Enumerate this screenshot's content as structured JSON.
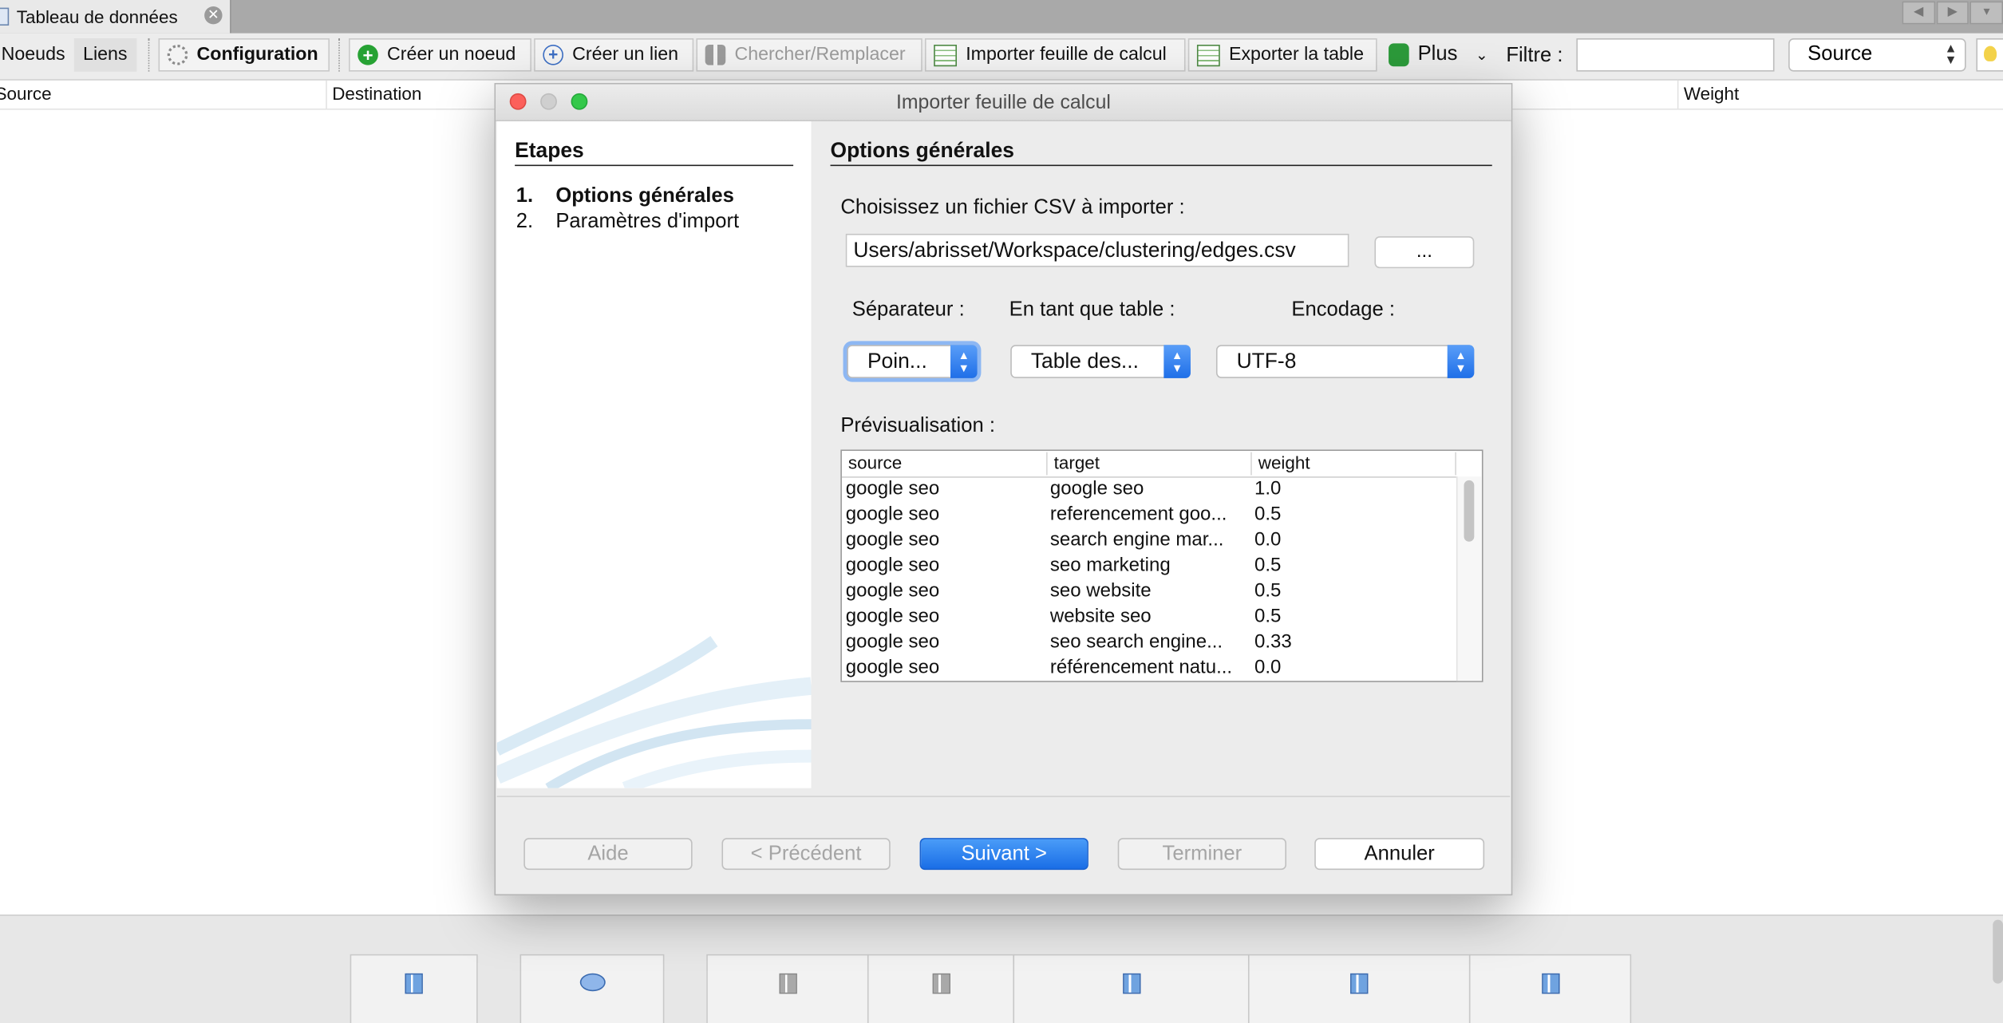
{
  "tab": {
    "title": "Tableau de données"
  },
  "toolbar": {
    "nodes": "Noeuds",
    "edges": "Liens",
    "config": "Configuration",
    "create_node": "Créer un noeud",
    "create_edge": "Créer un lien",
    "search_replace": "Chercher/Remplacer",
    "import_sheet": "Importer feuille de calcul",
    "export_table": "Exporter la table",
    "more": "Plus",
    "filter_label": "Filtre :",
    "filter_value": "",
    "source_select": "Source"
  },
  "table_headers": [
    "Source",
    "Destination",
    "Weight"
  ],
  "dialog": {
    "title": "Importer feuille de calcul",
    "steps_heading": "Etapes",
    "steps": [
      {
        "num": "1.",
        "label": "Options générales"
      },
      {
        "num": "2.",
        "label": "Paramètres d'import"
      }
    ],
    "section_heading": "Options générales",
    "choose_file_label": "Choisissez un fichier CSV à importer :",
    "file_path": "Users/abrisset/Workspace/clustering/edges.csv",
    "browse_button": "...",
    "separator_label": "Séparateur :",
    "as_table_label": "En tant que table :",
    "encoding_label": "Encodage :",
    "separator_value": "Poin...",
    "as_table_value": "Table des...",
    "encoding_value": "UTF-8",
    "preview_label": "Prévisualisation :",
    "preview": {
      "columns": [
        "source",
        "target",
        "weight"
      ],
      "rows": [
        [
          "google seo",
          "google seo",
          "1.0"
        ],
        [
          "google seo",
          "referencement goo...",
          "0.5"
        ],
        [
          "google seo",
          "search engine mar...",
          "0.0"
        ],
        [
          "google seo",
          "seo marketing",
          "0.5"
        ],
        [
          "google seo",
          "seo website",
          "0.5"
        ],
        [
          "google seo",
          "website seo",
          "0.5"
        ],
        [
          "google seo",
          "seo search engine...",
          "0.33"
        ],
        [
          "google seo",
          "référencement natu...",
          "0.0"
        ]
      ]
    },
    "buttons": {
      "help": "Aide",
      "previous": "< Précédent",
      "next": "Suivant >",
      "finish": "Terminer",
      "cancel": "Annuler"
    }
  }
}
